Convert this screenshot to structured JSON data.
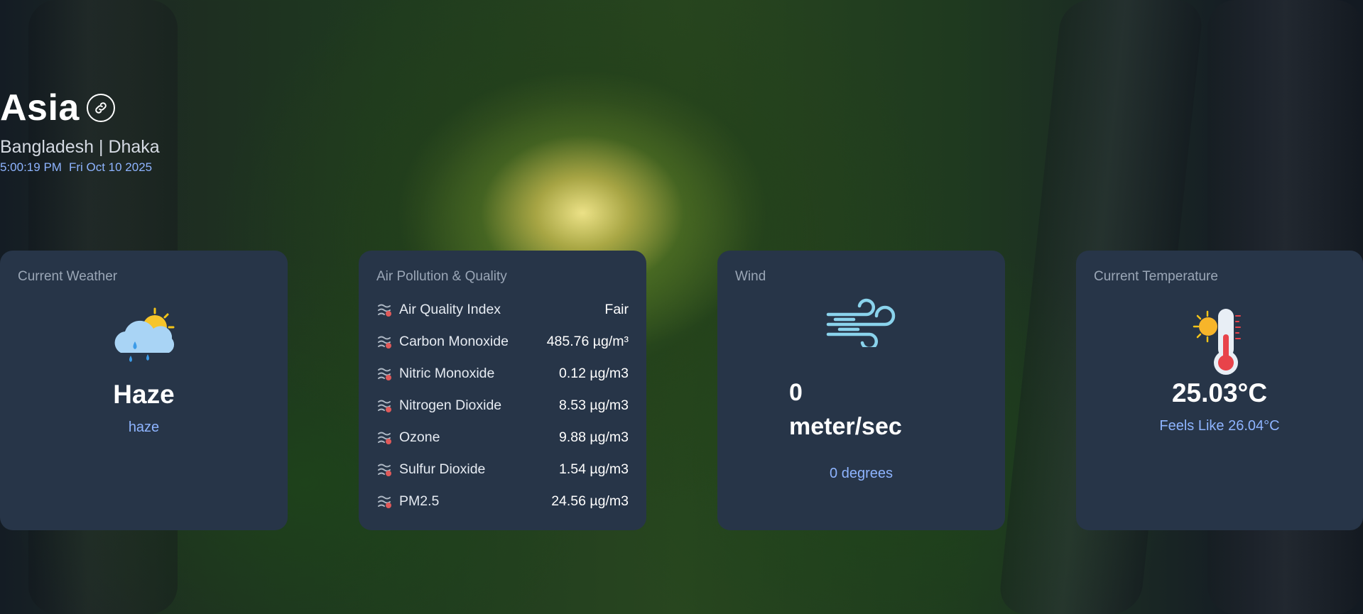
{
  "header": {
    "title": "Asia",
    "location": "Bangladesh | Dhaka",
    "time": "5:00:19 PM",
    "date": "Fri Oct 10 2025"
  },
  "icons": {
    "share_link": "link-icon",
    "weather": "cloud-sun-rain-icon",
    "pollutant": "smoke-icon",
    "wind": "wind-icon",
    "temperature": "thermometer-sun-icon"
  },
  "colors": {
    "card_bg": "#273548",
    "accent_text": "#8eb4ff",
    "card_title": "#9aa6b6"
  },
  "cards": {
    "weather": {
      "title": "Current Weather",
      "condition": "Haze",
      "description": "haze"
    },
    "air": {
      "title": "Air Pollution & Quality",
      "rows": [
        {
          "name": "Air Quality Index",
          "value": "Fair"
        },
        {
          "name": "Carbon Monoxide",
          "value": "485.76 µg/m³"
        },
        {
          "name": "Nitric Monoxide",
          "value": "0.12 µg/m3"
        },
        {
          "name": "Nitrogen Dioxide",
          "value": "8.53 µg/m3"
        },
        {
          "name": "Ozone",
          "value": "9.88 µg/m3"
        },
        {
          "name": "Sulfur Dioxide",
          "value": "1.54 µg/m3"
        },
        {
          "name": "PM2.5",
          "value": "24.56 µg/m3"
        }
      ]
    },
    "wind": {
      "title": "Wind",
      "speed": "0",
      "unit": "meter/sec",
      "direction": "0 degrees"
    },
    "temperature": {
      "title": "Current Temperature",
      "value": "25.03°C",
      "feels_like": "Feels Like 26.04°C"
    }
  }
}
